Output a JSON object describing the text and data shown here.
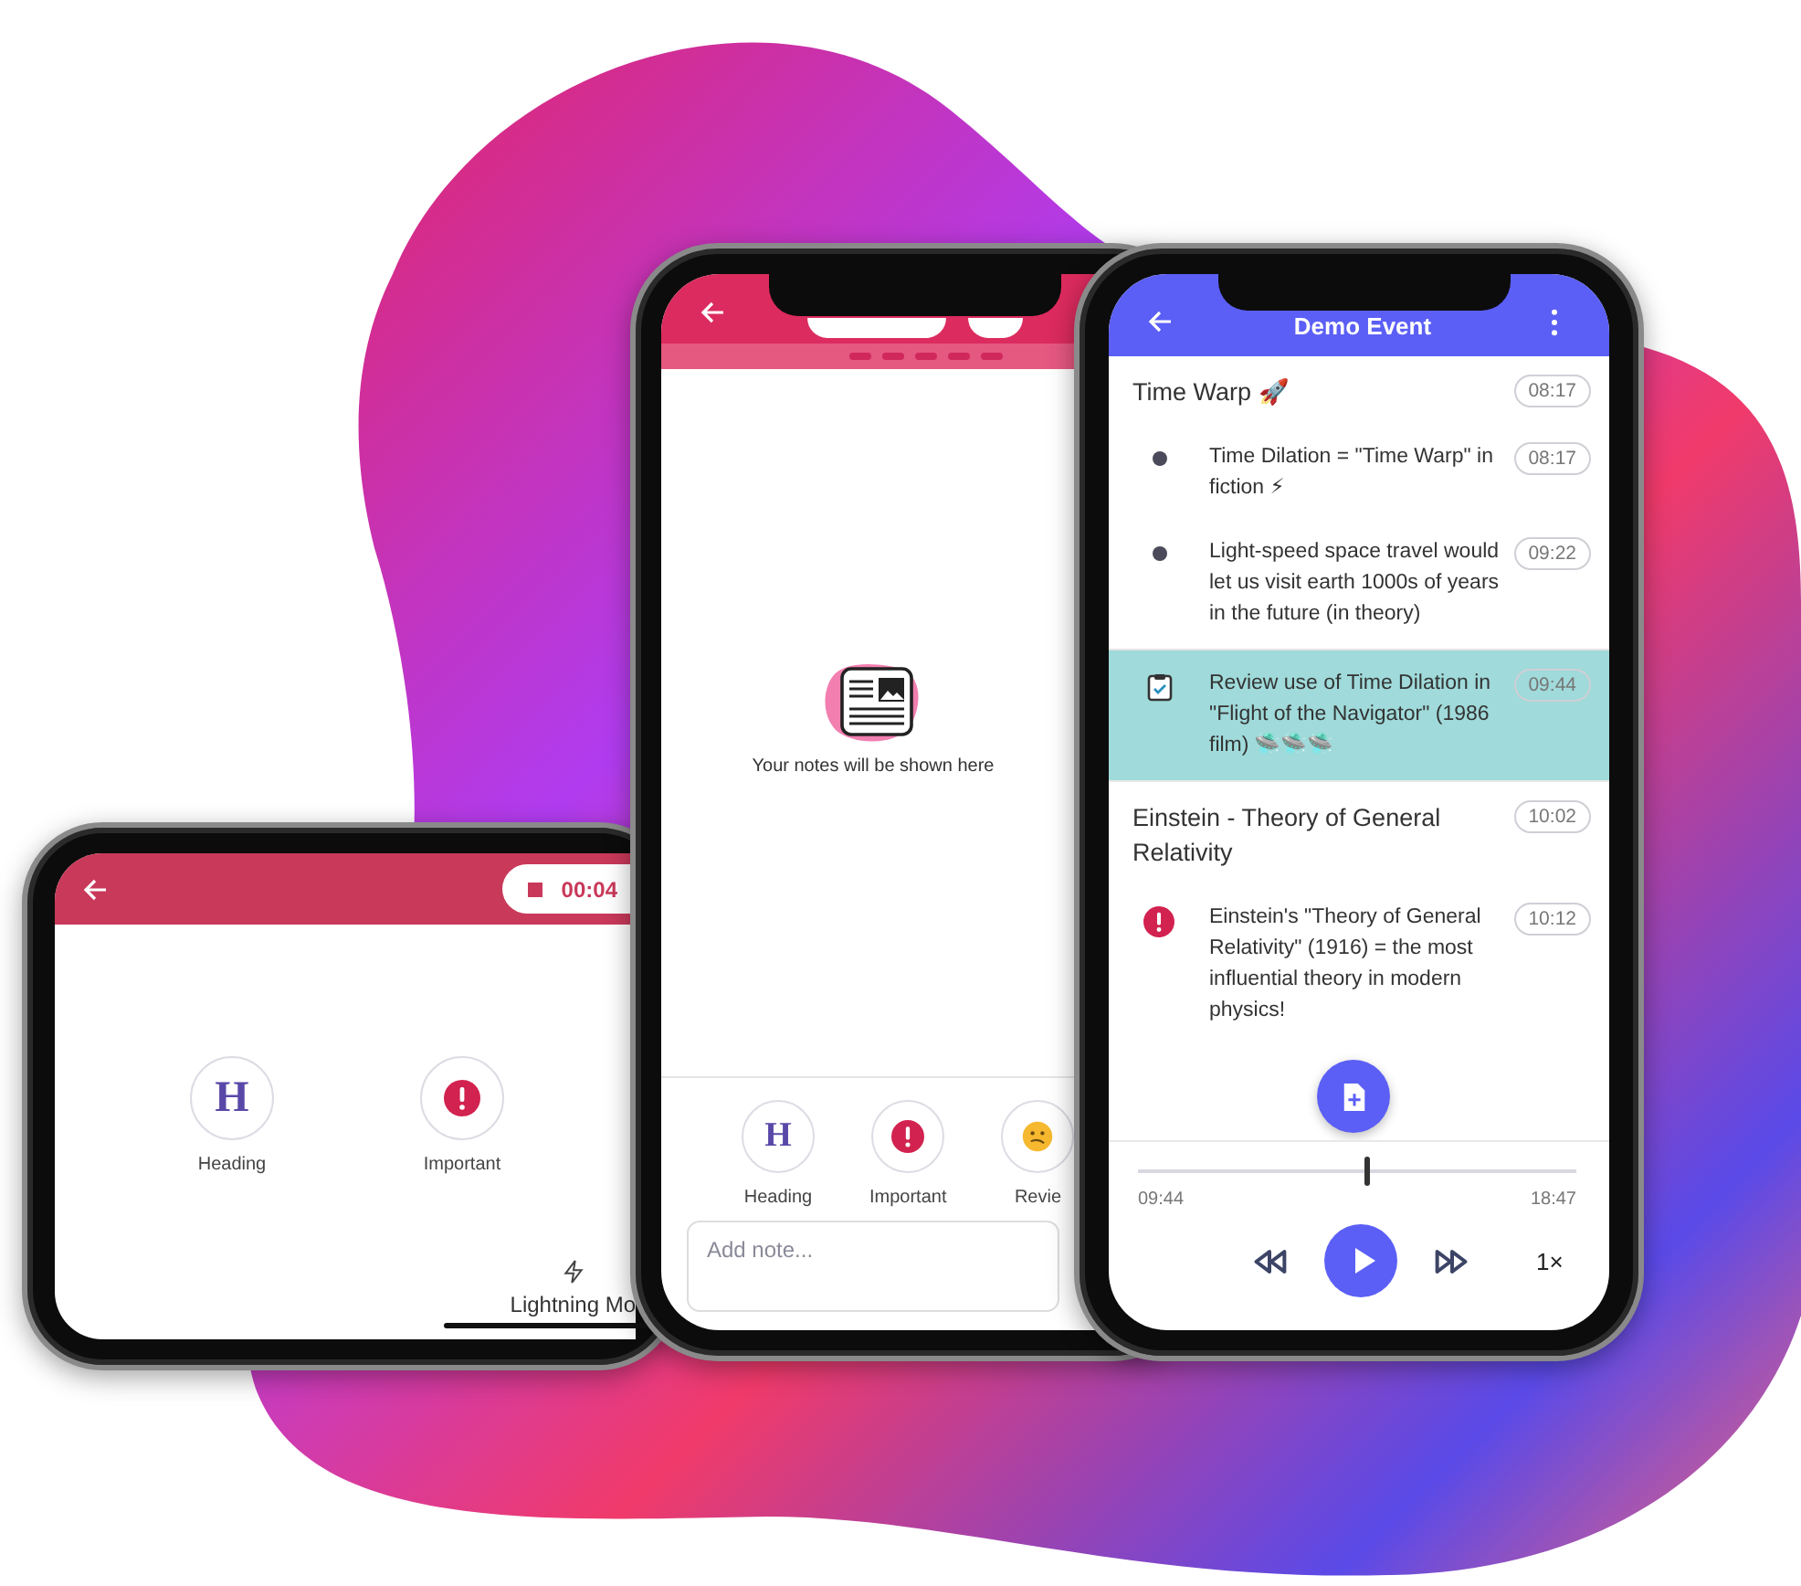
{
  "landscape_phone": {
    "timer": "00:04",
    "tags": [
      {
        "kind": "heading",
        "glyph": "H",
        "label": "Heading"
      },
      {
        "kind": "important",
        "label": "Important"
      }
    ],
    "mode_label": "Lightning Mo"
  },
  "notes_phone": {
    "empty_text": "Your notes will be shown here",
    "tags": [
      {
        "kind": "heading",
        "glyph": "H",
        "label": "Heading"
      },
      {
        "kind": "important",
        "label": "Important"
      },
      {
        "kind": "review",
        "label": "Revie"
      }
    ],
    "note_field": {
      "placeholder": "Add note..."
    }
  },
  "event_phone": {
    "title": "Demo Event",
    "sections": [
      {
        "title": "Time Warp 🚀",
        "time": "08:17",
        "notes": [
          {
            "kind": "bullet",
            "text": "Time Dilation = \"Time Warp\" in fiction ⚡",
            "time": "08:17",
            "selected": false
          },
          {
            "kind": "bullet",
            "text": "Light-speed space travel would let us visit earth 1000s of years in the future (in theory)",
            "time": "09:22",
            "selected": false
          },
          {
            "kind": "task",
            "text": "Review use of Time Dilation in \"Flight of the Navigator\" (1986 film) 🛸🛸🛸",
            "time": "09:44",
            "selected": true
          }
        ]
      },
      {
        "title": "Einstein - Theory of General Relativity",
        "time": "10:02",
        "notes": [
          {
            "kind": "important",
            "text": "Einstein's \"Theory of General Relativity\" (1916) = the most influential theory in modern physics!",
            "time": "10:12",
            "selected": false
          }
        ]
      }
    ],
    "player": {
      "level": 0.52,
      "elapsed": "09:44",
      "total": "18:47",
      "speed": "1×"
    }
  }
}
